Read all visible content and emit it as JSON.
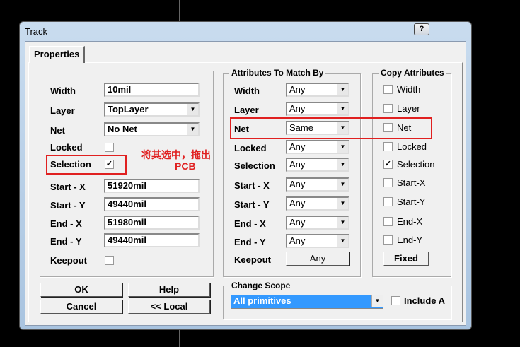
{
  "window": {
    "title": "Track",
    "help_label": "?"
  },
  "tab": "Properties",
  "props": [
    {
      "label": "Width",
      "value": "10mil",
      "type": "text"
    },
    {
      "label": "Layer",
      "value": "TopLayer",
      "type": "combo"
    },
    {
      "label": "Net",
      "value": "No Net",
      "type": "combo"
    },
    {
      "label": "Locked",
      "checked": false,
      "type": "check"
    },
    {
      "label": "Selection",
      "checked": true,
      "type": "check"
    },
    {
      "label": "Start - X",
      "value": "51920mil",
      "type": "text"
    },
    {
      "label": "Start - Y",
      "value": "49440mil",
      "type": "text"
    },
    {
      "label": "End - X",
      "value": "51980mil",
      "type": "text"
    },
    {
      "label": "End - Y",
      "value": "49440mil",
      "type": "text"
    },
    {
      "label": "Keepout",
      "checked": false,
      "type": "check"
    }
  ],
  "match": {
    "title": "Attributes To Match By",
    "rows": [
      {
        "label": "Width",
        "value": "Any"
      },
      {
        "label": "Layer",
        "value": "Any"
      },
      {
        "label": "Net",
        "value": "Same"
      },
      {
        "label": "Locked",
        "value": "Any"
      },
      {
        "label": "Selection",
        "value": "Any"
      },
      {
        "label": "Start - X",
        "value": "Any"
      },
      {
        "label": "Start - Y",
        "value": "Any"
      },
      {
        "label": "End - X",
        "value": "Any"
      },
      {
        "label": "End - Y",
        "value": "Any"
      }
    ],
    "keepout_label": "Keepout",
    "keepout_value": "Any"
  },
  "copy": {
    "title": "Copy Attributes",
    "items": [
      {
        "label": "Width",
        "checked": false
      },
      {
        "label": "Layer",
        "checked": false
      },
      {
        "label": "Net",
        "checked": false
      },
      {
        "label": "Locked",
        "checked": false
      },
      {
        "label": "Selection",
        "checked": true
      },
      {
        "label": "Start-X",
        "checked": false
      },
      {
        "label": "Start-Y",
        "checked": false
      },
      {
        "label": "End-X",
        "checked": false
      },
      {
        "label": "End-Y",
        "checked": false
      }
    ],
    "fixed_label": "Fixed"
  },
  "buttons": {
    "ok": "OK",
    "help": "Help",
    "cancel": "Cancel",
    "local": "<< Local"
  },
  "scope": {
    "title": "Change Scope",
    "value": "All primitives",
    "include_label": "Include A"
  },
  "annotation": {
    "line1": "将其选中，拖出",
    "line2": "PCB"
  }
}
